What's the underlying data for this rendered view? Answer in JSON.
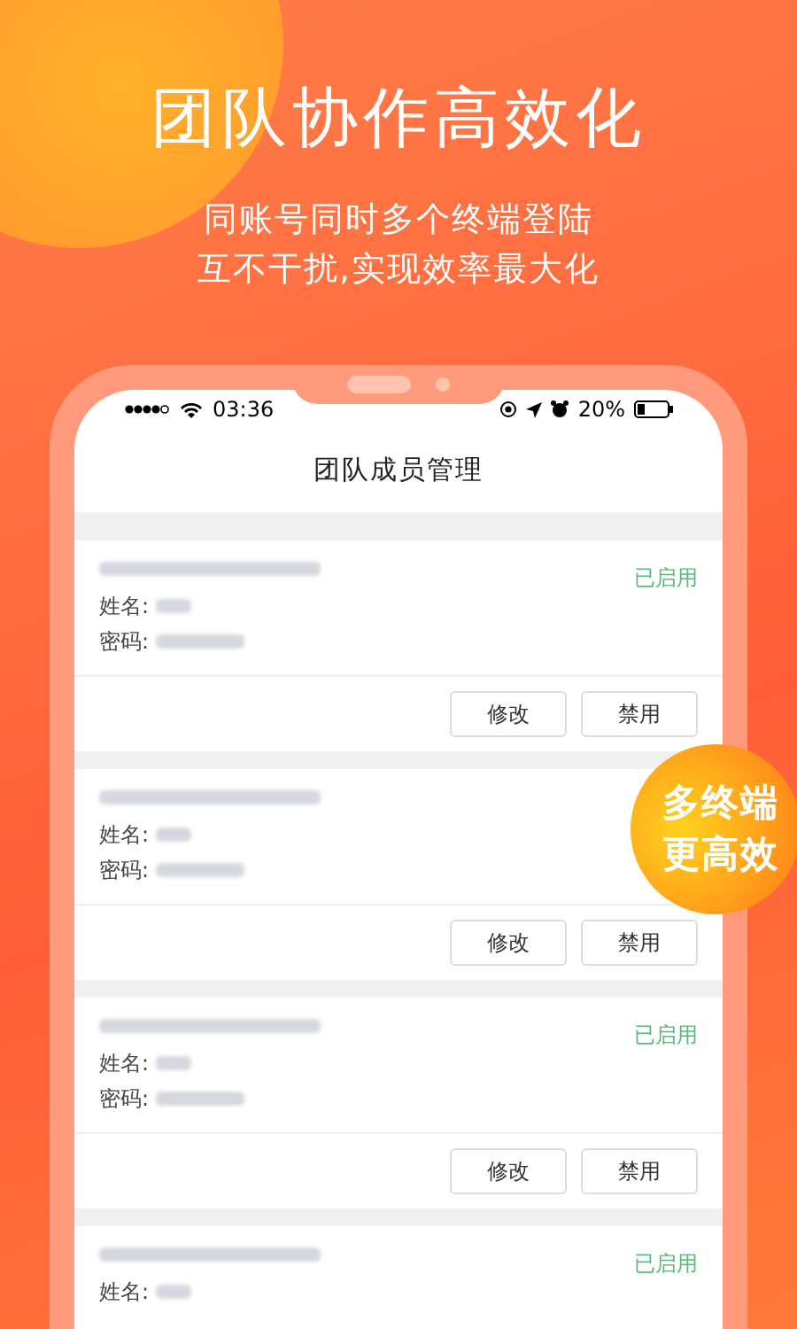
{
  "headline": "团队协作高效化",
  "subtitle": [
    "同账号同时多个终端登陆",
    "互不干扰,实现效率最大化"
  ],
  "status_bar": {
    "time": "03:36",
    "battery": "20%"
  },
  "screen_title": "团队成员管理",
  "cards": [
    {
      "status": "已启用",
      "fields": [
        {
          "label": "姓名:"
        },
        {
          "label": "密码:"
        }
      ],
      "buttons": [
        "修改",
        "禁用"
      ]
    },
    {
      "fields": [
        {
          "label": "姓名:"
        },
        {
          "label": "密码:"
        }
      ],
      "buttons": [
        "修改",
        "禁用"
      ]
    },
    {
      "status": "已启用",
      "fields": [
        {
          "label": "姓名:"
        },
        {
          "label": "密码:"
        }
      ],
      "buttons": [
        "修改",
        "禁用"
      ]
    },
    {
      "status": "已启用",
      "fields": [
        {
          "label": "姓名:"
        }
      ]
    }
  ],
  "badge": [
    "多终端",
    "更高效"
  ]
}
